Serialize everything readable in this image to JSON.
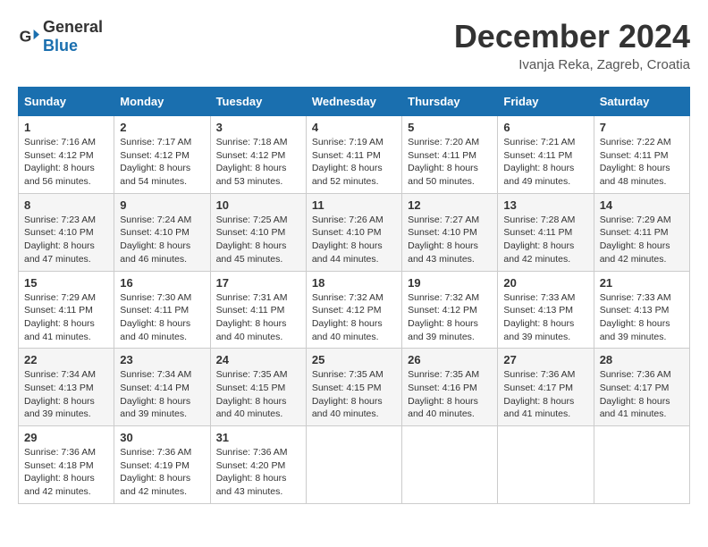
{
  "header": {
    "logo": {
      "general": "General",
      "blue": "Blue"
    },
    "title": "December 2024",
    "location": "Ivanja Reka, Zagreb, Croatia"
  },
  "calendar": {
    "days_of_week": [
      "Sunday",
      "Monday",
      "Tuesday",
      "Wednesday",
      "Thursday",
      "Friday",
      "Saturday"
    ],
    "weeks": [
      [
        {
          "day": "1",
          "sunrise": "7:16 AM",
          "sunset": "4:12 PM",
          "daylight": "8 hours and 56 minutes."
        },
        {
          "day": "2",
          "sunrise": "7:17 AM",
          "sunset": "4:12 PM",
          "daylight": "8 hours and 54 minutes."
        },
        {
          "day": "3",
          "sunrise": "7:18 AM",
          "sunset": "4:12 PM",
          "daylight": "8 hours and 53 minutes."
        },
        {
          "day": "4",
          "sunrise": "7:19 AM",
          "sunset": "4:11 PM",
          "daylight": "8 hours and 52 minutes."
        },
        {
          "day": "5",
          "sunrise": "7:20 AM",
          "sunset": "4:11 PM",
          "daylight": "8 hours and 50 minutes."
        },
        {
          "day": "6",
          "sunrise": "7:21 AM",
          "sunset": "4:11 PM",
          "daylight": "8 hours and 49 minutes."
        },
        {
          "day": "7",
          "sunrise": "7:22 AM",
          "sunset": "4:11 PM",
          "daylight": "8 hours and 48 minutes."
        }
      ],
      [
        {
          "day": "8",
          "sunrise": "7:23 AM",
          "sunset": "4:10 PM",
          "daylight": "8 hours and 47 minutes."
        },
        {
          "day": "9",
          "sunrise": "7:24 AM",
          "sunset": "4:10 PM",
          "daylight": "8 hours and 46 minutes."
        },
        {
          "day": "10",
          "sunrise": "7:25 AM",
          "sunset": "4:10 PM",
          "daylight": "8 hours and 45 minutes."
        },
        {
          "day": "11",
          "sunrise": "7:26 AM",
          "sunset": "4:10 PM",
          "daylight": "8 hours and 44 minutes."
        },
        {
          "day": "12",
          "sunrise": "7:27 AM",
          "sunset": "4:10 PM",
          "daylight": "8 hours and 43 minutes."
        },
        {
          "day": "13",
          "sunrise": "7:28 AM",
          "sunset": "4:11 PM",
          "daylight": "8 hours and 42 minutes."
        },
        {
          "day": "14",
          "sunrise": "7:29 AM",
          "sunset": "4:11 PM",
          "daylight": "8 hours and 42 minutes."
        }
      ],
      [
        {
          "day": "15",
          "sunrise": "7:29 AM",
          "sunset": "4:11 PM",
          "daylight": "8 hours and 41 minutes."
        },
        {
          "day": "16",
          "sunrise": "7:30 AM",
          "sunset": "4:11 PM",
          "daylight": "8 hours and 40 minutes."
        },
        {
          "day": "17",
          "sunrise": "7:31 AM",
          "sunset": "4:11 PM",
          "daylight": "8 hours and 40 minutes."
        },
        {
          "day": "18",
          "sunrise": "7:32 AM",
          "sunset": "4:12 PM",
          "daylight": "8 hours and 40 minutes."
        },
        {
          "day": "19",
          "sunrise": "7:32 AM",
          "sunset": "4:12 PM",
          "daylight": "8 hours and 39 minutes."
        },
        {
          "day": "20",
          "sunrise": "7:33 AM",
          "sunset": "4:13 PM",
          "daylight": "8 hours and 39 minutes."
        },
        {
          "day": "21",
          "sunrise": "7:33 AM",
          "sunset": "4:13 PM",
          "daylight": "8 hours and 39 minutes."
        }
      ],
      [
        {
          "day": "22",
          "sunrise": "7:34 AM",
          "sunset": "4:13 PM",
          "daylight": "8 hours and 39 minutes."
        },
        {
          "day": "23",
          "sunrise": "7:34 AM",
          "sunset": "4:14 PM",
          "daylight": "8 hours and 39 minutes."
        },
        {
          "day": "24",
          "sunrise": "7:35 AM",
          "sunset": "4:15 PM",
          "daylight": "8 hours and 40 minutes."
        },
        {
          "day": "25",
          "sunrise": "7:35 AM",
          "sunset": "4:15 PM",
          "daylight": "8 hours and 40 minutes."
        },
        {
          "day": "26",
          "sunrise": "7:35 AM",
          "sunset": "4:16 PM",
          "daylight": "8 hours and 40 minutes."
        },
        {
          "day": "27",
          "sunrise": "7:36 AM",
          "sunset": "4:17 PM",
          "daylight": "8 hours and 41 minutes."
        },
        {
          "day": "28",
          "sunrise": "7:36 AM",
          "sunset": "4:17 PM",
          "daylight": "8 hours and 41 minutes."
        }
      ],
      [
        {
          "day": "29",
          "sunrise": "7:36 AM",
          "sunset": "4:18 PM",
          "daylight": "8 hours and 42 minutes."
        },
        {
          "day": "30",
          "sunrise": "7:36 AM",
          "sunset": "4:19 PM",
          "daylight": "8 hours and 42 minutes."
        },
        {
          "day": "31",
          "sunrise": "7:36 AM",
          "sunset": "4:20 PM",
          "daylight": "8 hours and 43 minutes."
        },
        null,
        null,
        null,
        null
      ]
    ]
  }
}
